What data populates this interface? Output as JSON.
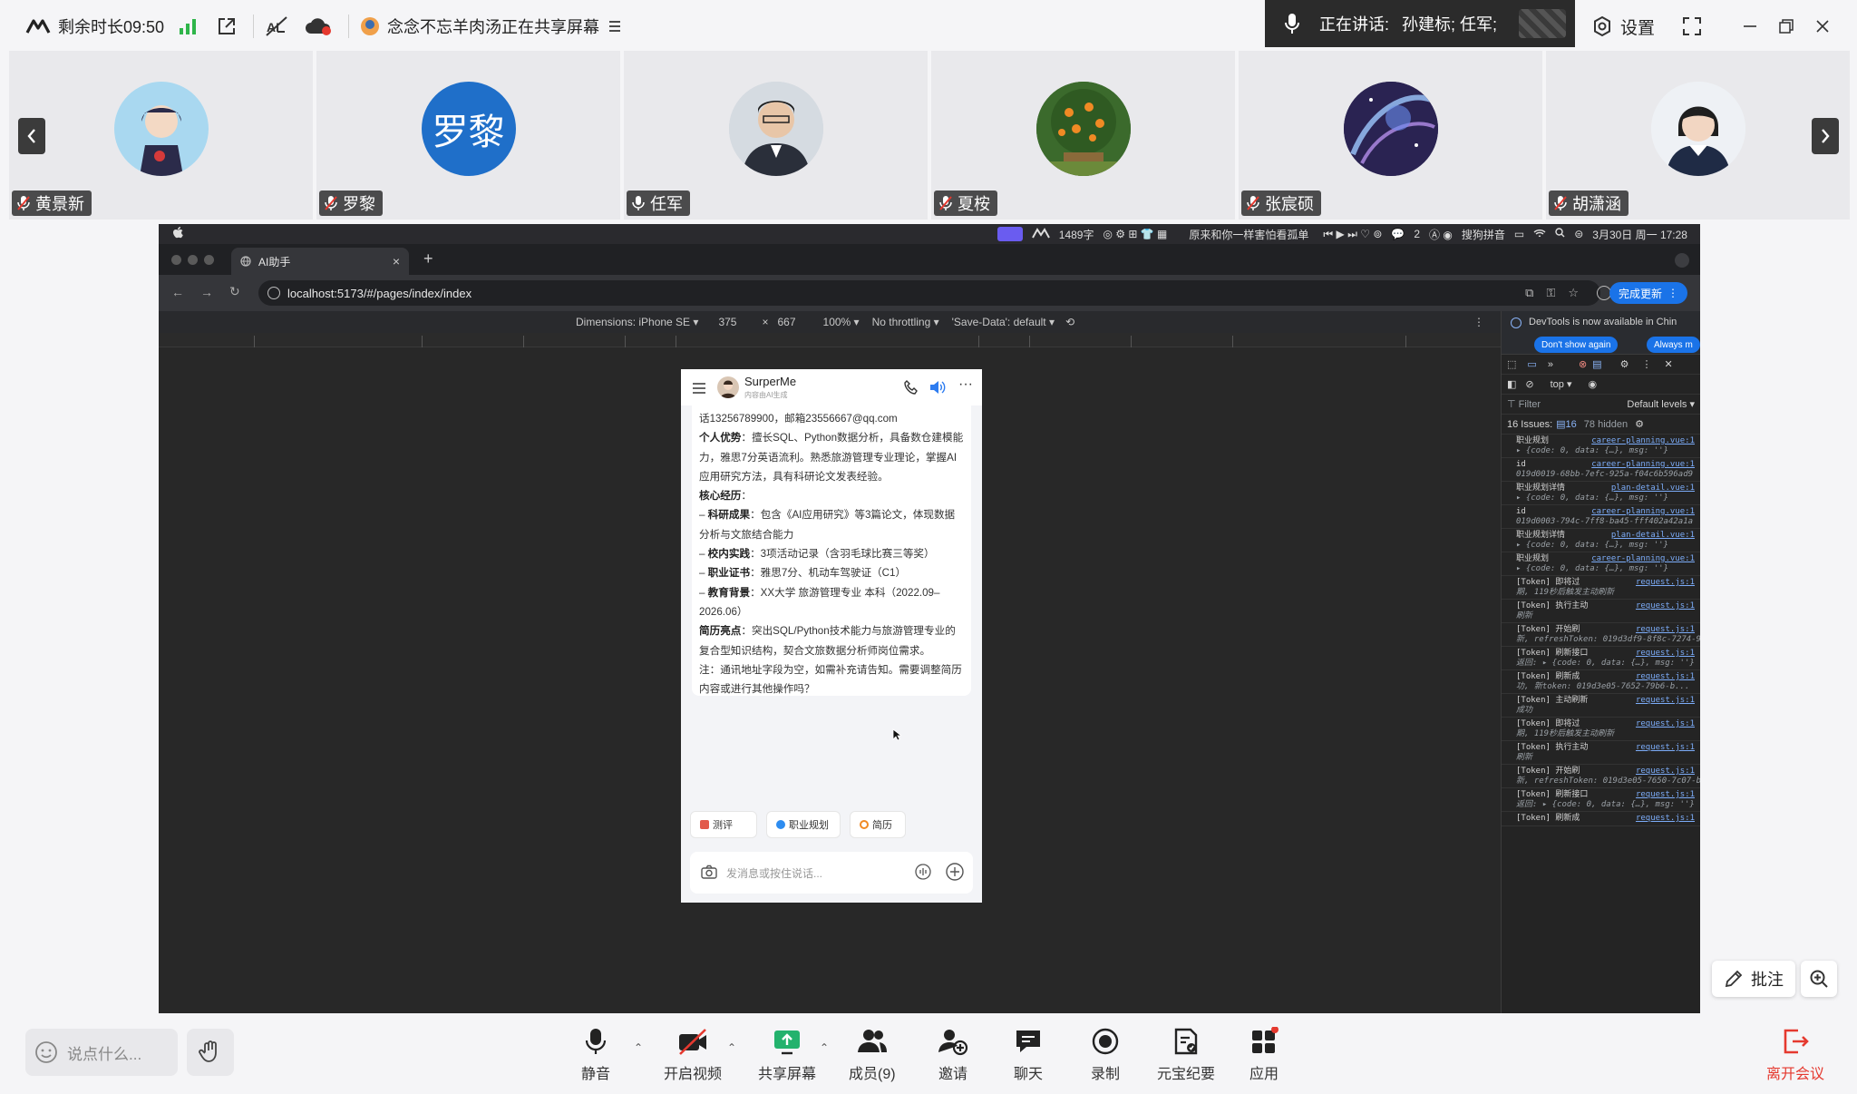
{
  "topbar": {
    "remaining": "剩余时长09:50",
    "sharer": "念念不忘羊肉汤正在共享屏幕",
    "speaking_label": "正在讲话:",
    "speaking_names": "孙建标; 任军;",
    "settings": "设置"
  },
  "participants": [
    {
      "name": "黄景新",
      "mic": "muted"
    },
    {
      "name": "罗黎",
      "mic": "muted",
      "avatar_text": "罗黎",
      "avatar_color": "#1f6fc9"
    },
    {
      "name": "任军",
      "mic": "on"
    },
    {
      "name": "夏桉",
      "mic": "muted"
    },
    {
      "name": "张宸硕",
      "mic": "muted"
    },
    {
      "name": "胡潇涵",
      "mic": "muted"
    }
  ],
  "mac": {
    "wordcount": "1489字",
    "song": "原来和你一样害怕看孤单",
    "chat_count": "2",
    "input_method": "搜狗拼音",
    "datetime": "3月30日 周一 17:28"
  },
  "browser": {
    "tab_title": "AI助手",
    "url": "localhost:5173/#/pages/index/index",
    "update_label": "完成更新",
    "device": "Dimensions: iPhone SE",
    "width": "375",
    "times": "×",
    "height": "667",
    "zoom": "100%",
    "throttle": "No throttling",
    "save_data": "'Save-Data': default"
  },
  "app": {
    "title": "SurperMe",
    "subtitle": "内容由AI生成",
    "message": {
      "contact": "话13256789900，邮箱23556667@qq.com",
      "adv_label": "个人优势",
      "adv_text": "：擅长SQL、Python数据分析，具备数仓建模能力，雅思7分英语流利。熟悉旅游管理专业理论，掌握AI应用研究方法，具有科研论文发表经验。",
      "core_label": "核心经历",
      "core_colon": "：",
      "items": [
        {
          "label": "科研成果",
          "text": "：包含《AI应用研究》等3篇论文，体现数据分析与文旅结合能力"
        },
        {
          "label": "校内实践",
          "text": "：3项活动记录（含羽毛球比赛三等奖）"
        },
        {
          "label": "职业证书",
          "text": "：雅思7分、机动车驾驶证（C1）"
        },
        {
          "label": "教育背景",
          "text": "：XX大学 旅游管理专业 本科（2022.09–2026.06）"
        }
      ],
      "highlight_label": "简历亮点",
      "highlight_text": "：突出SQL/Python技术能力与旅游管理专业的复合型知识结构，契合文旅数据分析师岗位需求。",
      "note": "注：通讯地址字段为空，如需补充请告知。需要调整简历内容或进行其他操作吗？"
    },
    "chips": [
      {
        "label": "测评",
        "color": "#e25a4a"
      },
      {
        "label": "职业规划",
        "color": "#2d8cf0"
      },
      {
        "label": "简历",
        "color": "#f08a24"
      }
    ],
    "input_placeholder": "发消息或按住说话..."
  },
  "devtools": {
    "banner": "DevTools is now available in Chin",
    "dont_show": "Don't show again",
    "always": "Always m",
    "context": "top",
    "filter": "Filter",
    "levels": "Default levels",
    "issues_label": "16 Issues:",
    "issues_count": "16",
    "hidden": "78 hidden",
    "logs": [
      {
        "text": "职业规划",
        "src": "career-planning.vue:1",
        "sub": "▸ {code: 0, data: {…}, msg: ''}"
      },
      {
        "text": "id",
        "src": "career-planning.vue:1",
        "sub": "019d0019-68bb-7efc-925a-f04c6b596ad9"
      },
      {
        "text": "职业规划详情",
        "src": "plan-detail.vue:1",
        "sub": "▸ {code: 0, data: {…}, msg: ''}"
      },
      {
        "text": "id",
        "src": "career-planning.vue:1",
        "sub": "019d0003-794c-7ff8-ba45-fff402a42a1a"
      },
      {
        "text": "职业规划详情",
        "src": "plan-detail.vue:1",
        "sub": "▸ {code: 0, data: {…}, msg: ''}"
      },
      {
        "text": "职业规划",
        "src": "career-planning.vue:1",
        "sub": "▸ {code: 0, data: {…}, msg: ''}"
      },
      {
        "text": "[Token] 即将过",
        "src": "request.js:1",
        "sub": "期, 119秒后触发主动刷新"
      },
      {
        "text": "[Token] 执行主动",
        "src": "request.js:1",
        "sub": "刷新"
      },
      {
        "text": "[Token] 开始刷",
        "src": "request.js:1",
        "sub": "新, refreshToken: 019d3df9-8f8c-7274-9..."
      },
      {
        "text": "[Token] 刷新接口",
        "src": "request.js:1",
        "sub": "返回: ▸ {code: 0, data: {…}, msg: ''}"
      },
      {
        "text": "[Token] 刷新成",
        "src": "request.js:1",
        "sub": "功, 新token: 019d3e05-7652-79b6-b..."
      },
      {
        "text": "[Token] 主动刷新",
        "src": "request.js:1",
        "sub": "成功"
      },
      {
        "text": "[Token] 即将过",
        "src": "request.js:1",
        "sub": "期, 119秒后触发主动刷新"
      },
      {
        "text": "[Token] 执行主动",
        "src": "request.js:1",
        "sub": "刷新"
      },
      {
        "text": "[Token] 开始刷",
        "src": "request.js:1",
        "sub": "新, refreshToken: 019d3e05-7650-7c07-b..."
      },
      {
        "text": "[Token] 刷新接口",
        "src": "request.js:1",
        "sub": "返回: ▸ {code: 0, data: {…}, msg: ''}"
      },
      {
        "text": "[Token] 刷新成",
        "src": "request.js:1",
        "sub": ""
      }
    ]
  },
  "annotate": "批注",
  "bottom": {
    "say_placeholder": "说点什么...",
    "tools": [
      {
        "label": "静音",
        "icon": "mic-icon"
      },
      {
        "label": "开启视频",
        "icon": "video-off-icon"
      },
      {
        "label": "共享屏幕",
        "icon": "share-screen-icon"
      },
      {
        "label": "成员(9)",
        "icon": "members-icon"
      },
      {
        "label": "邀请",
        "icon": "invite-icon"
      },
      {
        "label": "聊天",
        "icon": "chat-icon"
      },
      {
        "label": "录制",
        "icon": "record-icon"
      },
      {
        "label": "元宝纪要",
        "icon": "summary-icon"
      },
      {
        "label": "应用",
        "icon": "apps-icon"
      }
    ],
    "leave": "离开会议"
  },
  "colors": {
    "leave": "#e5392f",
    "accent": "#1a73e8",
    "speaking_bg": "#2b2b2b"
  }
}
